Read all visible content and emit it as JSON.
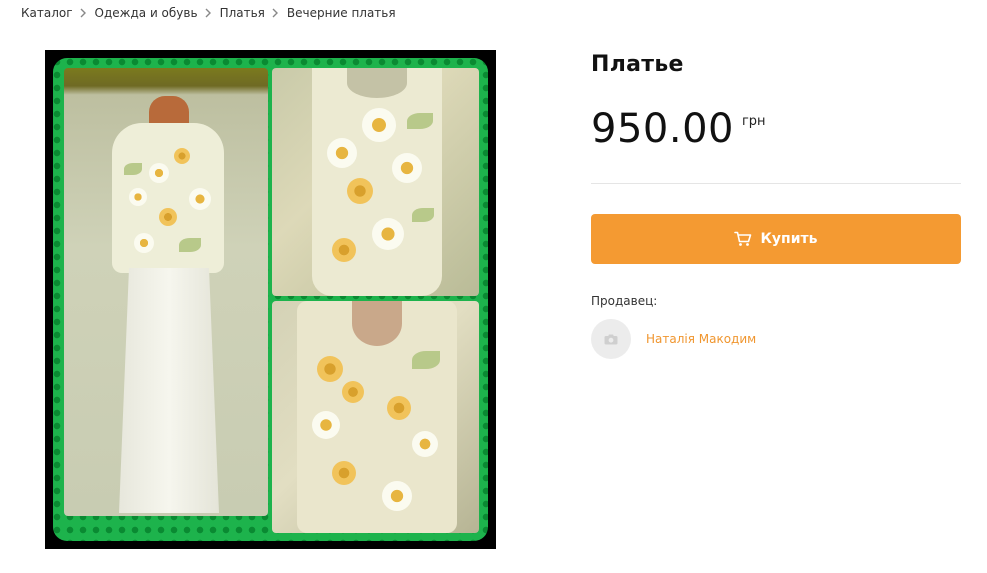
{
  "breadcrumb": [
    {
      "label": "Каталог"
    },
    {
      "label": "Одежда и обувь"
    },
    {
      "label": "Платья"
    },
    {
      "label": "Вечерние платья"
    }
  ],
  "product": {
    "title": "Платье",
    "price": "950.00",
    "currency": "грн"
  },
  "buy_button": {
    "label": "Купить",
    "icon": "cart-icon",
    "color": "#f49a32"
  },
  "seller": {
    "label": "Продавец:",
    "name": "Наталія Макодим",
    "avatar_icon": "camera-icon",
    "name_color": "#f0962f"
  },
  "gallery": {
    "frame_color": "#1db34c",
    "image_count": 3
  }
}
